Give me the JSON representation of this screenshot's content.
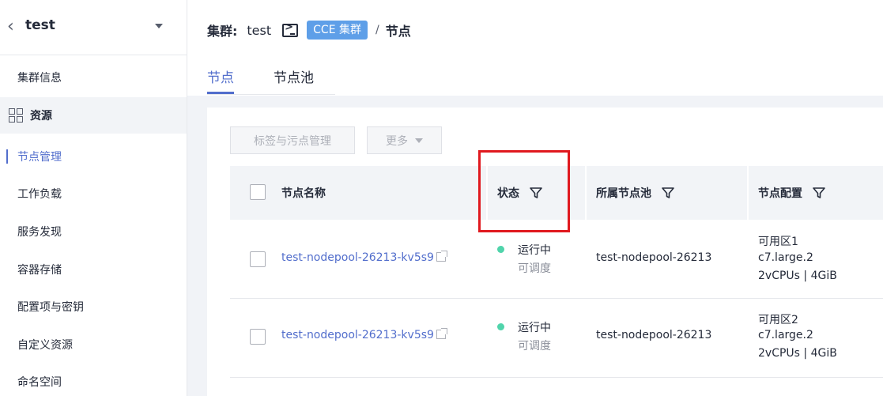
{
  "sidebar": {
    "cluster_name": "test",
    "items": [
      {
        "label": "集群信息"
      },
      {
        "label": "资源"
      },
      {
        "label": "节点管理"
      },
      {
        "label": "工作负载"
      },
      {
        "label": "服务发现"
      },
      {
        "label": "容器存储"
      },
      {
        "label": "配置项与密钥"
      },
      {
        "label": "自定义资源"
      },
      {
        "label": "命名空间"
      }
    ]
  },
  "header": {
    "cluster_label": "集群:",
    "cluster_value": "test",
    "badge": "CCE 集群",
    "separator": "/",
    "current": "节点"
  },
  "tabs": [
    {
      "label": "节点",
      "active": true
    },
    {
      "label": "节点池",
      "active": false
    }
  ],
  "toolbar": {
    "tag_button": "标签与污点管理",
    "more_button": "更多"
  },
  "table": {
    "columns": [
      "节点名称",
      "状态",
      "所属节点池",
      "节点配置"
    ],
    "rows": [
      {
        "name": "test-nodepool-26213-kv5s9",
        "status": "运行中",
        "schedulable": "可调度",
        "pool": "test-nodepool-26213",
        "config": [
          "可用区1",
          "c7.large.2",
          "2vCPUs | 4GiB"
        ]
      },
      {
        "name": "test-nodepool-26213-kv5s9",
        "status": "运行中",
        "schedulable": "可调度",
        "pool": "test-nodepool-26213",
        "config": [
          "可用区2",
          "c7.large.2",
          "2vCPUs | 4GiB"
        ]
      }
    ]
  },
  "colors": {
    "accent": "#526ecc",
    "status_running": "#50d4ab",
    "badge": "#5e9fe8",
    "highlight": "#e0191f"
  }
}
